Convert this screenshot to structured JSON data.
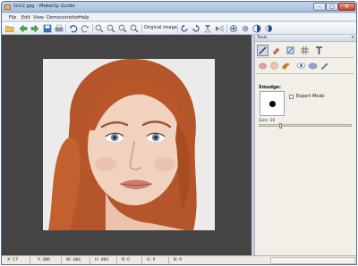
{
  "window": {
    "title": "Girl2.jpg - MakeUp Guide",
    "buttons": {
      "minimize": "–",
      "maximize": "□",
      "close": "✕"
    }
  },
  "menu": {
    "items": [
      "File",
      "Edit",
      "View",
      "Demonstration",
      "Help"
    ]
  },
  "toolbar": {
    "original_image_label": "Original image",
    "icons": [
      "open-folder-icon",
      "back-arrow-icon",
      "forward-arrow-icon",
      "save-icon",
      "print-icon",
      "undo-icon",
      "redo-icon",
      "zoom-in-icon",
      "zoom-out-icon",
      "zoom-fit-icon",
      "zoom-actual-icon",
      "rotate-left-icon",
      "rotate-right-icon",
      "flip-vertical-icon",
      "flip-horizontal-icon",
      "settings-icon",
      "settings-small-icon",
      "contrast-icon",
      "brightness-icon"
    ]
  },
  "panel": {
    "title": "Tools",
    "close": "×",
    "section_label": "Smudge:",
    "expert_mode": "Expert Mode",
    "expert_checked": false,
    "size_label": "Size: 10",
    "size_fraction": 0.22,
    "tools_row1": [
      "brush-tool-icon",
      "eraser-tool-icon",
      "crop-tool-icon",
      "grid-tool-icon",
      "text-tool-icon"
    ],
    "tools_row2": [
      "lipstick-tool-icon",
      "skin-tool-icon",
      "hair-tool-icon",
      "eye-tool-icon",
      "eyeshadow-tool-icon",
      "pencil-tool-icon"
    ]
  },
  "status": {
    "x": "X: 17",
    "y": "Y: 386",
    "w": "W: 484",
    "h": "H: 484",
    "r": "R: 0",
    "g": "G: 0",
    "b": "B: 0"
  },
  "colors": {
    "canvas_bg": "#444444",
    "panel_bg": "#f1efe8",
    "titlebar": "#b8cbea"
  }
}
